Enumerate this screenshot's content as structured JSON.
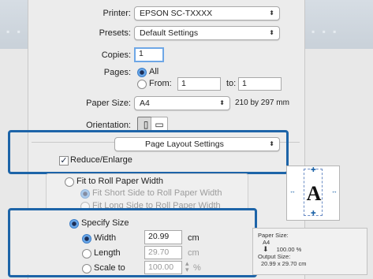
{
  "printer": {
    "label": "Printer:",
    "value": "EPSON SC-TXXXX"
  },
  "presets": {
    "label": "Presets:",
    "value": "Default Settings"
  },
  "copies": {
    "label": "Copies:",
    "value": "1"
  },
  "pages": {
    "label": "Pages:",
    "all": "All",
    "from": "From:",
    "from_value": "1",
    "to": "to:",
    "to_value": "1"
  },
  "paper_size": {
    "label": "Paper Size:",
    "value": "A4",
    "dimensions": "210 by 297 mm"
  },
  "orientation": {
    "label": "Orientation:"
  },
  "section": {
    "value": "Page Layout Settings"
  },
  "reduce_enlarge": {
    "label": "Reduce/Enlarge",
    "checked": true
  },
  "fit_roll": {
    "label": "Fit to Roll Paper Width",
    "sub1": "Fit Short Side to Roll Paper Width",
    "sub2": "Fit Long Side to Roll Paper Width"
  },
  "specify_size": {
    "label": "Specify Size",
    "width": {
      "label": "Width",
      "value": "20.99",
      "unit": "cm"
    },
    "length": {
      "label": "Length",
      "value": "29.70",
      "unit": "cm"
    },
    "scale": {
      "label": "Scale to",
      "value": "100.00",
      "unit": "%"
    }
  },
  "paper_info": {
    "paper_size_label": "Paper Size:",
    "paper_size_value": "A4",
    "percent": "100.00 %",
    "output_size_label": "Output Size:",
    "output_size_value": "20.99 x 29.70 cm"
  },
  "colors": {
    "highlight": "#1d64a8",
    "focus": "#6ea7e6",
    "radio_on": "#3f7fc7"
  },
  "icons": [
    "portrait-icon",
    "landscape-icon",
    "preview-letter-icon",
    "down-arrow-icon",
    "popup-arrows-icon",
    "check-icon"
  ]
}
